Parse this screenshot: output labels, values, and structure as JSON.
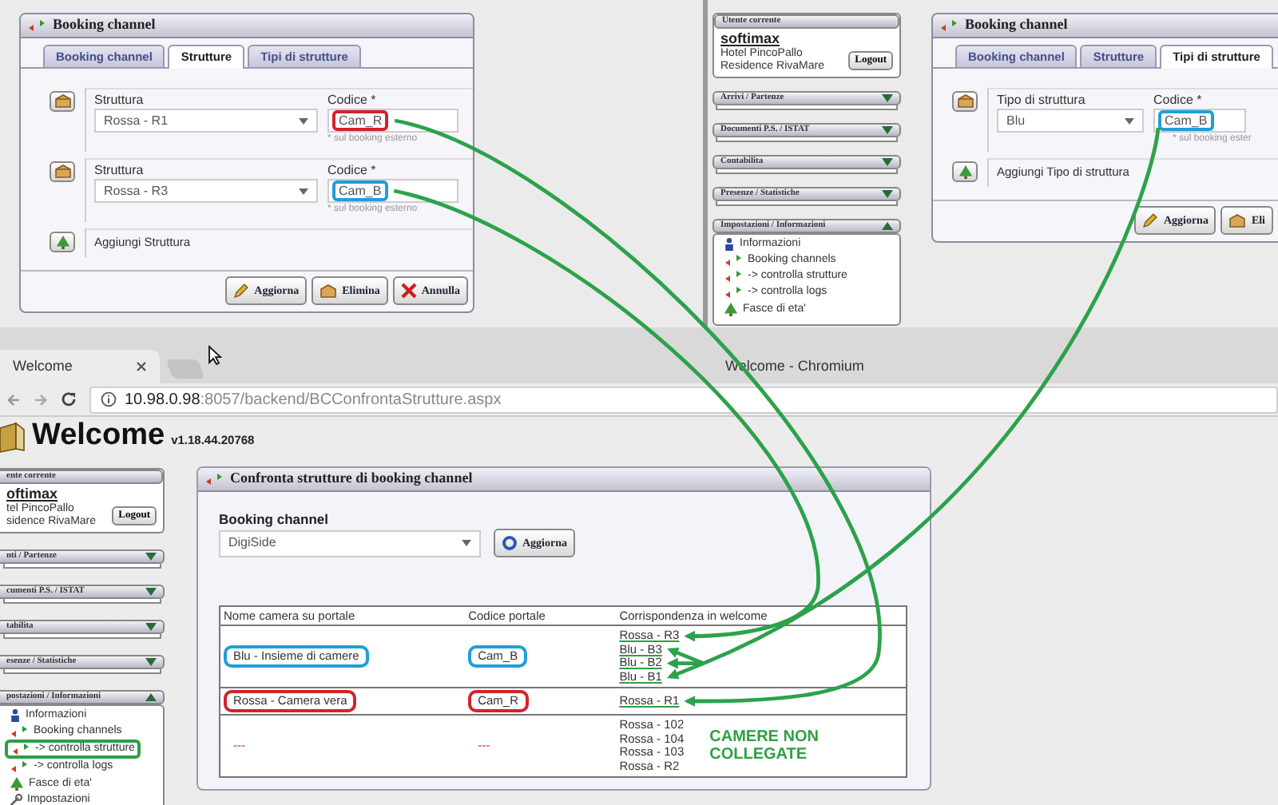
{
  "dialog_strutture": {
    "title": "Booking channel",
    "tabs": [
      {
        "label": "Booking channel",
        "selected": false
      },
      {
        "label": "Strutture",
        "selected": true
      },
      {
        "label": "Tipi di strutture",
        "selected": false
      }
    ],
    "rows": [
      {
        "field_label": "Struttura",
        "select": "Rossa - R1",
        "code_label": "Codice *",
        "code": "Cam_R",
        "hint": "* sul booking esterno",
        "color": "#d2232a"
      },
      {
        "field_label": "Struttura",
        "select": "Rossa - R3",
        "code_label": "Codice *",
        "code": "Cam_B",
        "hint": "* sul booking esterno",
        "color": "#1f9fd6"
      }
    ],
    "add_label": "Aggiungi Struttura",
    "buttons": [
      {
        "label": "Aggiorna",
        "kind": "update"
      },
      {
        "label": "Elimina",
        "kind": "delete"
      },
      {
        "label": "Annulla",
        "kind": "cancel"
      }
    ]
  },
  "sidebar_top": {
    "user_header": "Utente corrente",
    "user": "softimax",
    "hotels": [
      "Hotel PincoPallo",
      "Residence RivaMare"
    ],
    "logout": "Logout",
    "sections": [
      {
        "label": "Arrivi / Partenze",
        "expanded": false
      },
      {
        "label": "Documenti P.S. / ISTAT",
        "expanded": false
      },
      {
        "label": "Contabilita",
        "expanded": false
      },
      {
        "label": "Presenze / Statistiche",
        "expanded": false
      },
      {
        "label": "Impostazioni / Informazioni",
        "expanded": true,
        "items": [
          {
            "label": "Informazioni",
            "kind": "info"
          },
          {
            "label": "Booking channels",
            "kind": "exchange"
          },
          {
            "label": "-> controlla strutture",
            "kind": "exchange"
          },
          {
            "label": "-> controlla logs",
            "kind": "exchange"
          },
          {
            "label": "Fasce di eta'",
            "kind": "tree"
          }
        ]
      }
    ]
  },
  "dialog_tipi": {
    "title": "Booking channel",
    "tabs": [
      {
        "label": "Booking channel",
        "selected": false
      },
      {
        "label": "Strutture",
        "selected": false
      },
      {
        "label": "Tipi di strutture",
        "selected": true
      }
    ],
    "rows": [
      {
        "field_label": "Tipo di struttura",
        "select": "Blu",
        "code_label": "Codice *",
        "code": "Cam_B",
        "hint": "* sul booking ester",
        "color": "#1f9fd6"
      }
    ],
    "add_label": "Aggiungi Tipo di struttura",
    "buttons": [
      {
        "label": "Aggiorna",
        "kind": "update"
      },
      {
        "label": "Eli",
        "kind": "delete"
      }
    ]
  },
  "browser": {
    "tab": "Welcome",
    "window_title": "Welcome - Chromium",
    "url_host": "10.98.0.98",
    "url_path": ":8057/backend/BCConfrontaStrutture.aspx"
  },
  "app_header": {
    "title": "Welcome",
    "version": "v1.18.44.20768"
  },
  "sidebar": {
    "user_header": "ente corrente",
    "user": "oftimax",
    "hotels": [
      "tel PincoPallo",
      "sidence RivaMare"
    ],
    "logout": "Logout",
    "sections": [
      {
        "label": "nti / Partenze",
        "expanded": false
      },
      {
        "label": "cumenti P.S. / ISTAT",
        "expanded": false
      },
      {
        "label": "tabilita",
        "expanded": false
      },
      {
        "label": "esenze / Statistiche",
        "expanded": false
      },
      {
        "label": "postazioni / Informazioni",
        "expanded": true,
        "items": [
          {
            "label": "Informazioni",
            "kind": "info"
          },
          {
            "label": "Booking channels",
            "kind": "exchange"
          },
          {
            "label": "-> controlla strutture",
            "kind": "exchange",
            "color": "#2ea043"
          },
          {
            "label": "-> controlla logs",
            "kind": "exchange"
          },
          {
            "label": "Fasce di eta'",
            "kind": "tree"
          },
          {
            "label": "Impostazioni",
            "kind": "wrench"
          }
        ]
      }
    ]
  },
  "main_panel": {
    "title": "Confronta strutture di booking channel",
    "channel_label": "Booking channel",
    "channel": "DigiSide",
    "refresh": "Aggiorna",
    "table": {
      "columns": [
        "Nome camera su portale",
        "Codice portale",
        "Corrispondenza in welcome"
      ],
      "rows": [
        {
          "kind": "linked",
          "name": "Blu - Insieme di camere",
          "code": "Cam_B",
          "color": "#1f9fd6",
          "matches": [
            "Rossa - R3",
            "Blu - B3",
            "Blu - B2",
            "Blu - B1"
          ]
        },
        {
          "kind": "linked",
          "name": "Rossa - Camera vera",
          "code": "Cam_R",
          "color": "#d2232a",
          "matches": [
            "Rossa - R1"
          ]
        },
        {
          "kind": "unlinked",
          "name": "---",
          "code": "---",
          "matches": [
            "Rossa - 102",
            "Rossa - 104",
            "Rossa - 103",
            "Rossa - R2"
          ],
          "note": "CAMERE NON COLLEGATE"
        }
      ]
    }
  }
}
